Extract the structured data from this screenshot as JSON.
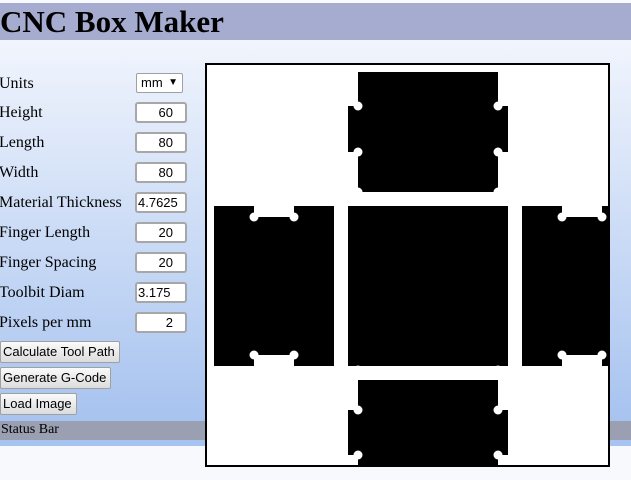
{
  "header": {
    "title": "CNC Box Maker"
  },
  "form": {
    "units": {
      "label": "Units",
      "value": "mm"
    },
    "fields": [
      {
        "label": "Height",
        "value": "60"
      },
      {
        "label": "Length",
        "value": "80"
      },
      {
        "label": "Width",
        "value": "80"
      },
      {
        "label": "Material Thickness",
        "value": "4.7625"
      },
      {
        "label": "Finger Length",
        "value": "20"
      },
      {
        "label": "Finger Spacing",
        "value": "20"
      },
      {
        "label": "Toolbit Diam",
        "value": "3.175"
      },
      {
        "label": "Pixels per mm",
        "value": "2"
      }
    ]
  },
  "buttons": {
    "calculate": "Calculate Tool Path",
    "gcode": "Generate G-Code",
    "load": "Load Image"
  },
  "status": {
    "text": "Status Bar"
  }
}
